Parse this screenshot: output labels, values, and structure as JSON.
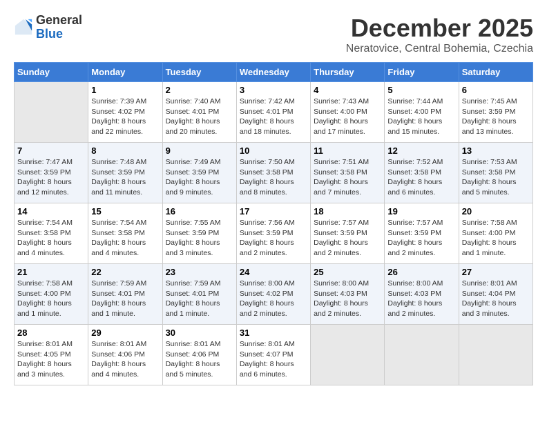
{
  "logo": {
    "general": "General",
    "blue": "Blue"
  },
  "title": {
    "month": "December 2025",
    "location": "Neratovice, Central Bohemia, Czechia"
  },
  "days_of_week": [
    "Sunday",
    "Monday",
    "Tuesday",
    "Wednesday",
    "Thursday",
    "Friday",
    "Saturday"
  ],
  "weeks": [
    [
      {
        "day": "",
        "info": ""
      },
      {
        "day": "1",
        "info": "Sunrise: 7:39 AM\nSunset: 4:02 PM\nDaylight: 8 hours\nand 22 minutes."
      },
      {
        "day": "2",
        "info": "Sunrise: 7:40 AM\nSunset: 4:01 PM\nDaylight: 8 hours\nand 20 minutes."
      },
      {
        "day": "3",
        "info": "Sunrise: 7:42 AM\nSunset: 4:01 PM\nDaylight: 8 hours\nand 18 minutes."
      },
      {
        "day": "4",
        "info": "Sunrise: 7:43 AM\nSunset: 4:00 PM\nDaylight: 8 hours\nand 17 minutes."
      },
      {
        "day": "5",
        "info": "Sunrise: 7:44 AM\nSunset: 4:00 PM\nDaylight: 8 hours\nand 15 minutes."
      },
      {
        "day": "6",
        "info": "Sunrise: 7:45 AM\nSunset: 3:59 PM\nDaylight: 8 hours\nand 13 minutes."
      }
    ],
    [
      {
        "day": "7",
        "info": "Sunrise: 7:47 AM\nSunset: 3:59 PM\nDaylight: 8 hours\nand 12 minutes."
      },
      {
        "day": "8",
        "info": "Sunrise: 7:48 AM\nSunset: 3:59 PM\nDaylight: 8 hours\nand 11 minutes."
      },
      {
        "day": "9",
        "info": "Sunrise: 7:49 AM\nSunset: 3:59 PM\nDaylight: 8 hours\nand 9 minutes."
      },
      {
        "day": "10",
        "info": "Sunrise: 7:50 AM\nSunset: 3:58 PM\nDaylight: 8 hours\nand 8 minutes."
      },
      {
        "day": "11",
        "info": "Sunrise: 7:51 AM\nSunset: 3:58 PM\nDaylight: 8 hours\nand 7 minutes."
      },
      {
        "day": "12",
        "info": "Sunrise: 7:52 AM\nSunset: 3:58 PM\nDaylight: 8 hours\nand 6 minutes."
      },
      {
        "day": "13",
        "info": "Sunrise: 7:53 AM\nSunset: 3:58 PM\nDaylight: 8 hours\nand 5 minutes."
      }
    ],
    [
      {
        "day": "14",
        "info": "Sunrise: 7:54 AM\nSunset: 3:58 PM\nDaylight: 8 hours\nand 4 minutes."
      },
      {
        "day": "15",
        "info": "Sunrise: 7:54 AM\nSunset: 3:58 PM\nDaylight: 8 hours\nand 4 minutes."
      },
      {
        "day": "16",
        "info": "Sunrise: 7:55 AM\nSunset: 3:59 PM\nDaylight: 8 hours\nand 3 minutes."
      },
      {
        "day": "17",
        "info": "Sunrise: 7:56 AM\nSunset: 3:59 PM\nDaylight: 8 hours\nand 2 minutes."
      },
      {
        "day": "18",
        "info": "Sunrise: 7:57 AM\nSunset: 3:59 PM\nDaylight: 8 hours\nand 2 minutes."
      },
      {
        "day": "19",
        "info": "Sunrise: 7:57 AM\nSunset: 3:59 PM\nDaylight: 8 hours\nand 2 minutes."
      },
      {
        "day": "20",
        "info": "Sunrise: 7:58 AM\nSunset: 4:00 PM\nDaylight: 8 hours\nand 1 minute."
      }
    ],
    [
      {
        "day": "21",
        "info": "Sunrise: 7:58 AM\nSunset: 4:00 PM\nDaylight: 8 hours\nand 1 minute."
      },
      {
        "day": "22",
        "info": "Sunrise: 7:59 AM\nSunset: 4:01 PM\nDaylight: 8 hours\nand 1 minute."
      },
      {
        "day": "23",
        "info": "Sunrise: 7:59 AM\nSunset: 4:01 PM\nDaylight: 8 hours\nand 1 minute."
      },
      {
        "day": "24",
        "info": "Sunrise: 8:00 AM\nSunset: 4:02 PM\nDaylight: 8 hours\nand 2 minutes."
      },
      {
        "day": "25",
        "info": "Sunrise: 8:00 AM\nSunset: 4:03 PM\nDaylight: 8 hours\nand 2 minutes."
      },
      {
        "day": "26",
        "info": "Sunrise: 8:00 AM\nSunset: 4:03 PM\nDaylight: 8 hours\nand 2 minutes."
      },
      {
        "day": "27",
        "info": "Sunrise: 8:01 AM\nSunset: 4:04 PM\nDaylight: 8 hours\nand 3 minutes."
      }
    ],
    [
      {
        "day": "28",
        "info": "Sunrise: 8:01 AM\nSunset: 4:05 PM\nDaylight: 8 hours\nand 3 minutes."
      },
      {
        "day": "29",
        "info": "Sunrise: 8:01 AM\nSunset: 4:06 PM\nDaylight: 8 hours\nand 4 minutes."
      },
      {
        "day": "30",
        "info": "Sunrise: 8:01 AM\nSunset: 4:06 PM\nDaylight: 8 hours\nand 5 minutes."
      },
      {
        "day": "31",
        "info": "Sunrise: 8:01 AM\nSunset: 4:07 PM\nDaylight: 8 hours\nand 6 minutes."
      },
      {
        "day": "",
        "info": ""
      },
      {
        "day": "",
        "info": ""
      },
      {
        "day": "",
        "info": ""
      }
    ]
  ]
}
